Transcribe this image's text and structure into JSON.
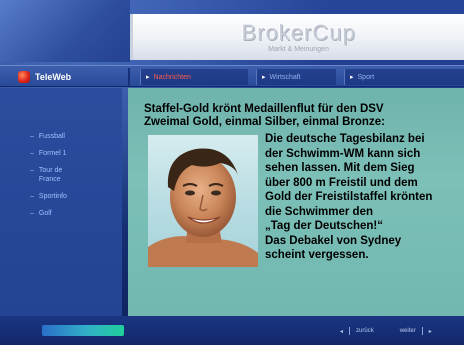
{
  "banner": {
    "title": "BrokerCup",
    "subtitle": "Markt & Meinungen"
  },
  "navbar": {
    "brand_name": "TeleWeb",
    "items": [
      {
        "label": "Nachrichten",
        "style": "red"
      },
      {
        "label": "Wirtschaft",
        "style": "pale"
      },
      {
        "label": "Sport",
        "style": "pale"
      }
    ]
  },
  "sidebar": {
    "items": [
      {
        "label": "Fussball"
      },
      {
        "label": "Formel 1"
      },
      {
        "label": "Tour de France"
      },
      {
        "label": "Sportinfo"
      },
      {
        "label": "Golf"
      }
    ]
  },
  "article": {
    "headline": "Staffel-Gold krönt Medaillenflut für den DSV",
    "subline": "Zweimal Gold, einmal Silber, einmal Bronze:",
    "body_lines": [
      "Die deutsche Tagesbilanz bei",
      "der Schwimm-WM kann sich",
      "sehen lassen. Mit dem Sieg",
      "über 800 m Freistil und dem",
      "Gold der Freistilstaffel krönten",
      "die Schwimmer den",
      "„Tag der Deutschen!“",
      "Das Debakel von Sydney",
      "scheint vergessen."
    ]
  },
  "footer": {
    "prev_label": "zurück",
    "next_label": "weiter"
  },
  "colors": {
    "background": "#1b3684",
    "content_bg": "#72b8b0",
    "brand_red": "#e0261b",
    "nav_red": "#ff5a4a",
    "sidebar_text": "#9fc0ff"
  }
}
